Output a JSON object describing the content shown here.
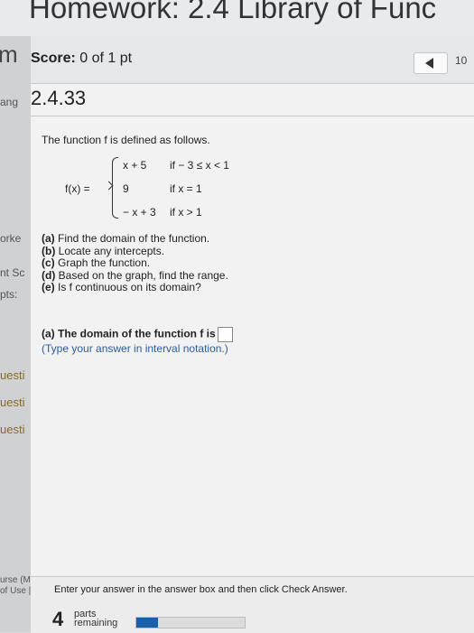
{
  "header": {
    "title": "Homework: 2.4 Library of Func"
  },
  "left_column": {
    "fragments": [
      "m",
      "ang",
      "orke",
      "nt Sc",
      "pts:",
      "uesti",
      "uesti",
      "uesti",
      "urse (MA",
      "of Use | P"
    ]
  },
  "score": {
    "label": "Score:",
    "value": "0 of 1 pt"
  },
  "nav": {
    "question_number": "10"
  },
  "section": {
    "number": "2.4.33"
  },
  "problem": {
    "intro": "The function f is defined as follows.",
    "fx_label": "f(x) =",
    "pieces": [
      {
        "expr": "x + 5",
        "cond": "if  − 3 ≤ x < 1"
      },
      {
        "expr": "9",
        "cond": "if x = 1"
      },
      {
        "expr": "− x + 3",
        "cond": "if x > 1"
      }
    ],
    "parts": [
      {
        "tag": "(a)",
        "text": "Find the domain of the function."
      },
      {
        "tag": "(b)",
        "text": "Locate any intercepts."
      },
      {
        "tag": "(c)",
        "text": "Graph the function."
      },
      {
        "tag": "(d)",
        "text": "Based on the graph, find the range."
      },
      {
        "tag": "(e)",
        "text": "Is f continuous on its domain?"
      }
    ]
  },
  "answer": {
    "prompt": "(a) The domain of the function f is",
    "hint": "(Type your answer in interval notation.)"
  },
  "footer": {
    "instruction": "Enter your answer in the answer box and then click Check Answer.",
    "parts_remaining": "4",
    "parts_label_1": "parts",
    "parts_label_2": "remaining",
    "progress_fraction": 0.2
  },
  "colors": {
    "hint": "#2b5d9c",
    "progress": "#1a5fa8"
  }
}
